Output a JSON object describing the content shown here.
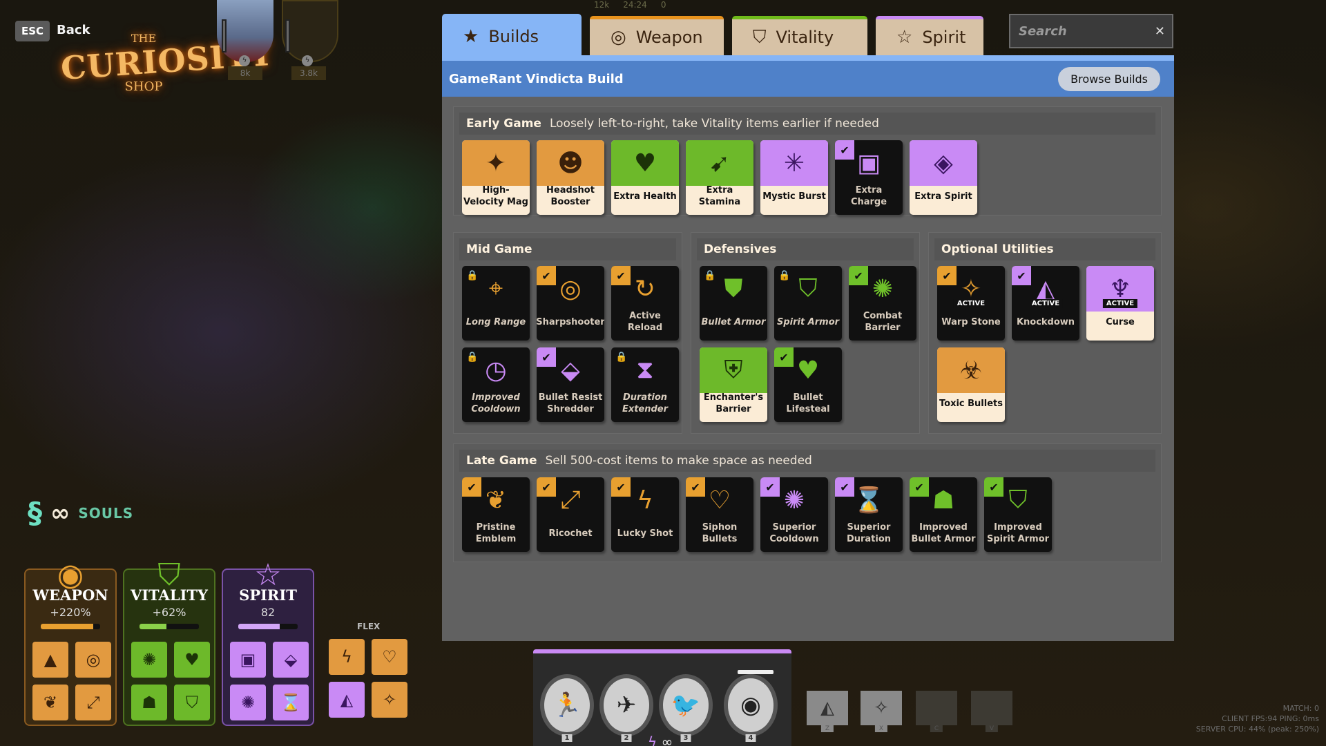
{
  "nav": {
    "esc_key": "ESC",
    "back_label": "Back"
  },
  "logo": {
    "line1": "THE",
    "line2": "CURIOSITY",
    "line3": "SHOP"
  },
  "portraits": [
    {
      "value": "8k"
    },
    {
      "value": "3.8k"
    }
  ],
  "top_stats": {
    "team1": "12k",
    "timer": "24:24",
    "team2": "0"
  },
  "tabs": [
    {
      "label": "Builds",
      "icon": "star-icon",
      "active": true
    },
    {
      "label": "Weapon",
      "icon": "weapon-icon"
    },
    {
      "label": "Vitality",
      "icon": "vitality-icon"
    },
    {
      "label": "Spirit",
      "icon": "spirit-icon"
    }
  ],
  "search": {
    "placeholder": "Search",
    "value": ""
  },
  "build": {
    "title": "GameRant Vindicta Build",
    "browse_label": "Browse Builds"
  },
  "sections": {
    "early": {
      "name": "Early Game",
      "desc": "Loosely left-to-right, take Vitality items earlier if needed",
      "items": [
        {
          "name": "High-Velocity Mag",
          "cat": "w",
          "state": "owned",
          "glyph": "✦"
        },
        {
          "name": "Headshot Booster",
          "cat": "w",
          "state": "owned",
          "glyph": "☻"
        },
        {
          "name": "Extra Health",
          "cat": "v",
          "state": "owned",
          "glyph": "♥"
        },
        {
          "name": "Extra Stamina",
          "cat": "v",
          "state": "owned",
          "glyph": "➹"
        },
        {
          "name": "Mystic Burst",
          "cat": "s",
          "state": "owned",
          "glyph": "✳"
        },
        {
          "name": "Extra Charge",
          "cat": "s",
          "state": "checked",
          "glyph": "▣"
        },
        {
          "name": "Extra Spirit",
          "cat": "s",
          "state": "owned",
          "glyph": "◈"
        }
      ]
    },
    "mid": {
      "name": "Mid Game",
      "items": [
        {
          "name": "Long Range",
          "cat": "w",
          "state": "locked",
          "glyph": "⌖"
        },
        {
          "name": "Sharpshooter",
          "cat": "w",
          "state": "checked",
          "glyph": "◎"
        },
        {
          "name": "Active Reload",
          "cat": "w",
          "state": "checked",
          "glyph": "↻"
        },
        {
          "name": "Improved Cooldown",
          "cat": "s",
          "state": "locked",
          "glyph": "◷"
        },
        {
          "name": "Bullet Resist Shredder",
          "cat": "s",
          "state": "checked",
          "glyph": "⬙"
        },
        {
          "name": "Duration Extender",
          "cat": "s",
          "state": "locked",
          "glyph": "⧗"
        }
      ]
    },
    "defensives": {
      "name": "Defensives",
      "items": [
        {
          "name": "Bullet Armor",
          "cat": "v",
          "state": "locked",
          "glyph": "⛊"
        },
        {
          "name": "Spirit Armor",
          "cat": "v",
          "state": "locked",
          "glyph": "⛉"
        },
        {
          "name": "Combat Barrier",
          "cat": "v",
          "state": "checked",
          "glyph": "✺"
        },
        {
          "name": "Enchanter's Barrier",
          "cat": "v",
          "state": "owned",
          "glyph": "⛨"
        },
        {
          "name": "Bullet Lifesteal",
          "cat": "v",
          "state": "checked",
          "glyph": "♥"
        }
      ]
    },
    "optional": {
      "name": "Optional Utilities",
      "items": [
        {
          "name": "Warp Stone",
          "cat": "w",
          "state": "checked",
          "glyph": "✧",
          "active_tag": "ACTIVE"
        },
        {
          "name": "Knockdown",
          "cat": "s",
          "state": "checked",
          "glyph": "◭",
          "active_tag": "ACTIVE"
        },
        {
          "name": "Curse",
          "cat": "s",
          "state": "owned",
          "glyph": "♆",
          "active_tag": "ACTIVE"
        },
        {
          "name": "Toxic Bullets",
          "cat": "w",
          "state": "owned",
          "glyph": "☣"
        }
      ]
    },
    "late": {
      "name": "Late Game",
      "desc": "Sell 500-cost items to make space as needed",
      "items": [
        {
          "name": "Pristine Emblem",
          "cat": "w",
          "state": "checked",
          "glyph": "❦"
        },
        {
          "name": "Ricochet",
          "cat": "w",
          "state": "checked",
          "glyph": "⤢"
        },
        {
          "name": "Lucky Shot",
          "cat": "w",
          "state": "checked",
          "glyph": "ϟ"
        },
        {
          "name": "Siphon Bullets",
          "cat": "w",
          "state": "checked",
          "glyph": "♡"
        },
        {
          "name": "Superior Cooldown",
          "cat": "s",
          "state": "checked",
          "glyph": "✺"
        },
        {
          "name": "Superior Duration",
          "cat": "s",
          "state": "checked",
          "glyph": "⌛"
        },
        {
          "name": "Improved Bullet Armor",
          "cat": "v",
          "state": "checked",
          "glyph": "☗"
        },
        {
          "name": "Improved Spirit Armor",
          "cat": "v",
          "state": "checked",
          "glyph": "⛉"
        }
      ]
    }
  },
  "souls": {
    "label": "SOULS"
  },
  "stats": [
    {
      "key": "weapon",
      "title": "WEAPON",
      "value": "+220%",
      "fill": 0.88,
      "color": "#e8a030",
      "slots": [
        "▲",
        "◎",
        "❦",
        "⤢"
      ]
    },
    {
      "key": "vitality",
      "title": "VITALITY",
      "value": "+62%",
      "fill": 0.45,
      "color": "#8bd04a",
      "slots": [
        "✺",
        "♥",
        "☗",
        "⛉"
      ]
    },
    {
      "key": "spirit",
      "title": "SPIRIT",
      "value": "82",
      "fill": 0.7,
      "color": "#d3a6f8",
      "slots": [
        "▣",
        "⬙",
        "✺",
        "⌛"
      ]
    }
  ],
  "flex": {
    "label": "FLEX",
    "slots": [
      {
        "glyph": "ϟ",
        "cat": "w"
      },
      {
        "glyph": "♡",
        "cat": "w"
      },
      {
        "glyph": "◭",
        "cat": "s"
      },
      {
        "glyph": "✧",
        "cat": "w"
      }
    ]
  },
  "abilities": [
    {
      "key": "1",
      "glyph": "🏃"
    },
    {
      "key": "2",
      "glyph": "✈"
    },
    {
      "key": "3",
      "glyph": "🐦"
    },
    {
      "key": "4",
      "glyph": "◉"
    }
  ],
  "quick_slots": [
    {
      "key": "Z",
      "glyph": "◭",
      "filled": true
    },
    {
      "key": "X",
      "glyph": "✧",
      "filled": true
    },
    {
      "key": "C",
      "filled": false
    },
    {
      "key": "V",
      "filled": false
    }
  ],
  "debug": {
    "match": "MATCH: 0",
    "client": "CLIENT FPS:94   PING: 0ms",
    "server": "SERVER CPU: 44% (peak: 250%)"
  }
}
